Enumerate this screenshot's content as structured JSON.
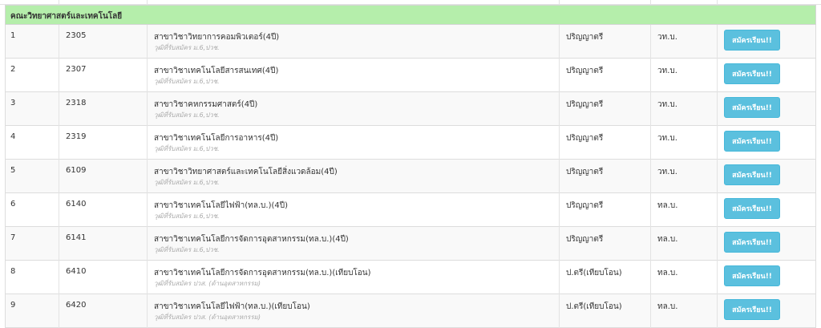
{
  "section_title": "คณะวิทยาศาสตร์และเทคโนโลยี",
  "rows": [
    {
      "no": "1",
      "code": "2305",
      "program": "สาขาวิชาวิทยาการคอมพิวเตอร์(4ปี)",
      "requirement": "วุฒิที่รับสมัคร ม.6,ปวช.",
      "degree": "ปริญญาตรี",
      "abbr": "วท.บ.",
      "button": "สมัครเรียน!!"
    },
    {
      "no": "2",
      "code": "2307",
      "program": "สาขาวิชาเทคโนโลยีสารสนเทศ(4ปี)",
      "requirement": "วุฒิที่รับสมัคร ม.6,ปวช.",
      "degree": "ปริญญาตรี",
      "abbr": "วท.บ.",
      "button": "สมัครเรียน!!"
    },
    {
      "no": "3",
      "code": "2318",
      "program": "สาขาวิชาคหกรรมศาสตร์(4ปี)",
      "requirement": "วุฒิที่รับสมัคร ม.6,ปวช.",
      "degree": "ปริญญาตรี",
      "abbr": "วท.บ.",
      "button": "สมัครเรียน!!"
    },
    {
      "no": "4",
      "code": "2319",
      "program": "สาขาวิชาเทคโนโลยีการอาหาร(4ปี)",
      "requirement": "วุฒิที่รับสมัคร ม.6,ปวช.",
      "degree": "ปริญญาตรี",
      "abbr": "วท.บ.",
      "button": "สมัครเรียน!!"
    },
    {
      "no": "5",
      "code": "6109",
      "program": "สาขาวิชาวิทยาศาสตร์และเทคโนโลยีสิ่งแวดล้อม(4ปี)",
      "requirement": "วุฒิที่รับสมัคร ม.6,ปวช.",
      "degree": "ปริญญาตรี",
      "abbr": "วท.บ.",
      "button": "สมัครเรียน!!"
    },
    {
      "no": "6",
      "code": "6140",
      "program": "สาขาวิชาเทคโนโลยีไฟฟ้า(ทล.บ.)(4ปี)",
      "requirement": "วุฒิที่รับสมัคร ม.6,ปวช.",
      "degree": "ปริญญาตรี",
      "abbr": "ทล.บ.",
      "button": "สมัครเรียน!!"
    },
    {
      "no": "7",
      "code": "6141",
      "program": "สาขาวิชาเทคโนโลยีการจัดการอุตสาหกรรม(ทล.บ.)(4ปี)",
      "requirement": "วุฒิที่รับสมัคร ม.6,ปวช.",
      "degree": "ปริญญาตรี",
      "abbr": "ทล.บ.",
      "button": "สมัครเรียน!!"
    },
    {
      "no": "8",
      "code": "6410",
      "program": "สาขาวิชาเทคโนโลยีการจัดการอุตสาหกรรม(ทล.บ.)(เทียบโอน)",
      "requirement": "วุฒิที่รับสมัคร ปวส. (ด้านอุตสาหกรรม)",
      "degree": "ป.ตรี(เทียบโอน)",
      "abbr": "ทล.บ.",
      "button": "สมัครเรียน!!"
    },
    {
      "no": "9",
      "code": "6420",
      "program": "สาขาวิชาเทคโนโลยีไฟฟ้า(ทล.บ.)(เทียบโอน)",
      "requirement": "วุฒิที่รับสมัคร ปวส. (ด้านอุตสาหกรรม)",
      "degree": "ป.ตรี(เทียบโอน)",
      "abbr": "ทล.บ.",
      "button": "สมัครเรียน!!"
    }
  ]
}
